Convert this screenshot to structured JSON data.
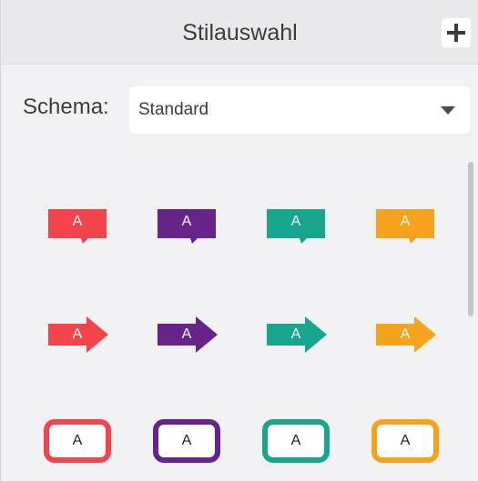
{
  "panel": {
    "title": "Stilauswahl",
    "add_icon": "plus-icon"
  },
  "schema": {
    "label": "Schema:",
    "selected": "Standard",
    "dropdown_icon": "chevron-down-icon"
  },
  "colors": {
    "red": "#f2444a",
    "purple": "#66248b",
    "teal": "#17a68d",
    "orange": "#f5a31d"
  },
  "styles": {
    "callouts": [
      {
        "letter": "A",
        "color": "red"
      },
      {
        "letter": "A",
        "color": "purple"
      },
      {
        "letter": "A",
        "color": "teal"
      },
      {
        "letter": "A",
        "color": "orange"
      }
    ],
    "arrows": [
      {
        "letter": "A",
        "color": "red"
      },
      {
        "letter": "A",
        "color": "purple"
      },
      {
        "letter": "A",
        "color": "teal"
      },
      {
        "letter": "A",
        "color": "orange"
      }
    ],
    "boxes": [
      {
        "letter": "A",
        "color": "red"
      },
      {
        "letter": "A",
        "color": "purple"
      },
      {
        "letter": "A",
        "color": "teal"
      },
      {
        "letter": "A",
        "color": "orange"
      }
    ]
  }
}
